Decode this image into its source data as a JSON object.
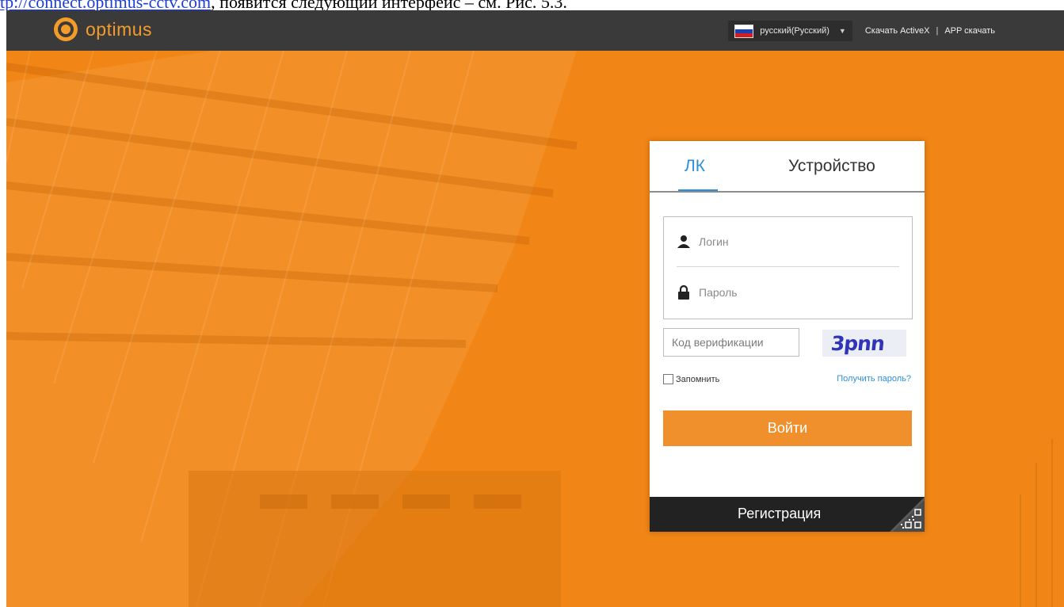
{
  "doc_caption": {
    "link_fragment": "tp://connect.optimus-cctv.com",
    "text_fragment": ", появится следующий интерфейс – см. Рис. 5.3."
  },
  "header": {
    "brand": "optimus",
    "language": "русский(Русский)",
    "download_activex": "Скачать ActiveX",
    "separator": "|",
    "app_download": "APP скачать"
  },
  "login": {
    "tabs": [
      {
        "label": "ЛК",
        "active": true
      },
      {
        "label": "Устройство",
        "active": false
      }
    ],
    "username_placeholder": "Логин",
    "password_placeholder": "Пароль",
    "verification_placeholder": "Код верификации",
    "captcha": "3pnn",
    "remember_label": "Запомнить",
    "remember_checked": false,
    "forgot_link": "Получить пароль?",
    "submit_label": "Войти",
    "register_label": "Регистрация"
  },
  "icons": {
    "logo": "optimus-logo-icon",
    "flag": "russia-flag-icon",
    "dropdown": "caret-down-icon",
    "user": "user-icon",
    "lock": "lock-icon",
    "qr": "qr-code-icon"
  },
  "colors": {
    "topbar": "#3b3a3a",
    "brand_orange": "#f39c2a",
    "background_orange": "#f18515",
    "tab_active": "#2a8fd8",
    "button": "#f0902d",
    "register_bar": "#222222"
  }
}
